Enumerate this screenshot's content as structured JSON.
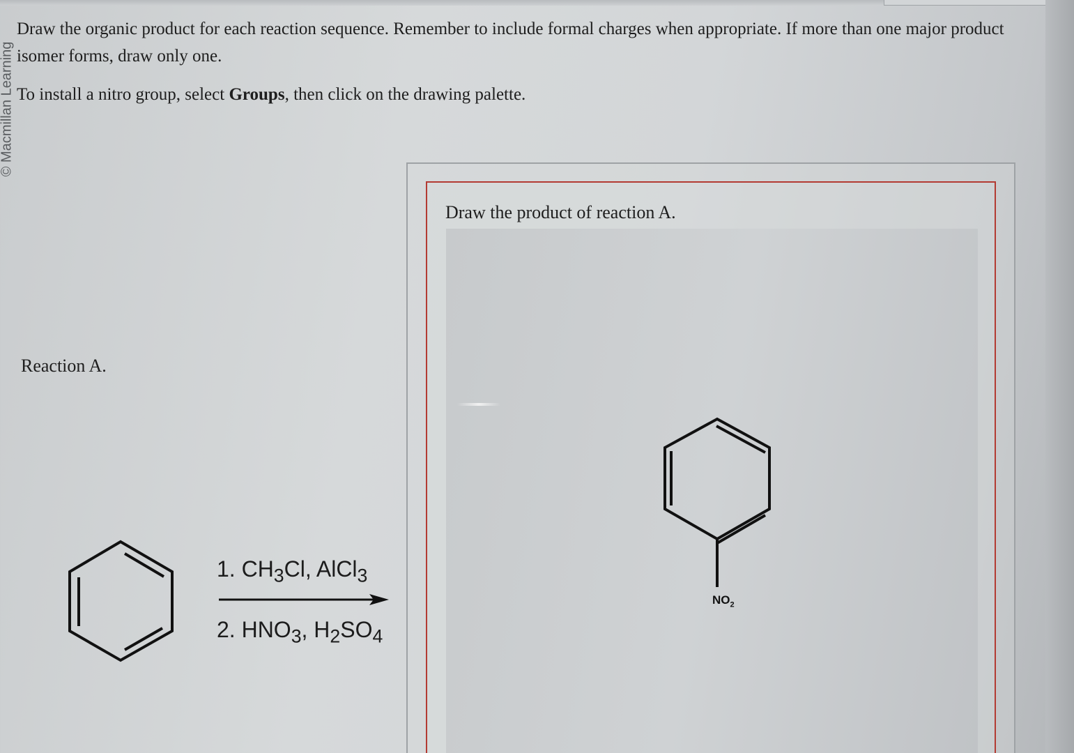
{
  "instructions": {
    "line1": "Draw the organic product for each reaction sequence. Remember to include formal charges when appropriate. If more than one major product isomer forms, draw only one.",
    "line2_prefix": "To install a nitro group, select ",
    "line2_bold": "Groups",
    "line2_suffix": ", then click on the drawing palette."
  },
  "copyright": "© Macmillan Learning",
  "reaction": {
    "label": "Reaction A.",
    "step1": {
      "prefix": "1. CH",
      "sub1": "3",
      "mid": "Cl, AlCl",
      "sub2": "3"
    },
    "step2": {
      "prefix": "2. HNO",
      "sub1": "3",
      "mid": ", H",
      "sub2": "2",
      "mid2": "SO",
      "sub3": "4"
    },
    "starting_material_icon": "benzene-ring"
  },
  "answer": {
    "prompt": "Draw the product of reaction A.",
    "drawn_structure_icon": "nitrobenzene",
    "group_label": "NO",
    "group_label_sub": "2"
  },
  "colors": {
    "answer_border": "#b33a32",
    "panel_border": "#9ea2a5"
  }
}
